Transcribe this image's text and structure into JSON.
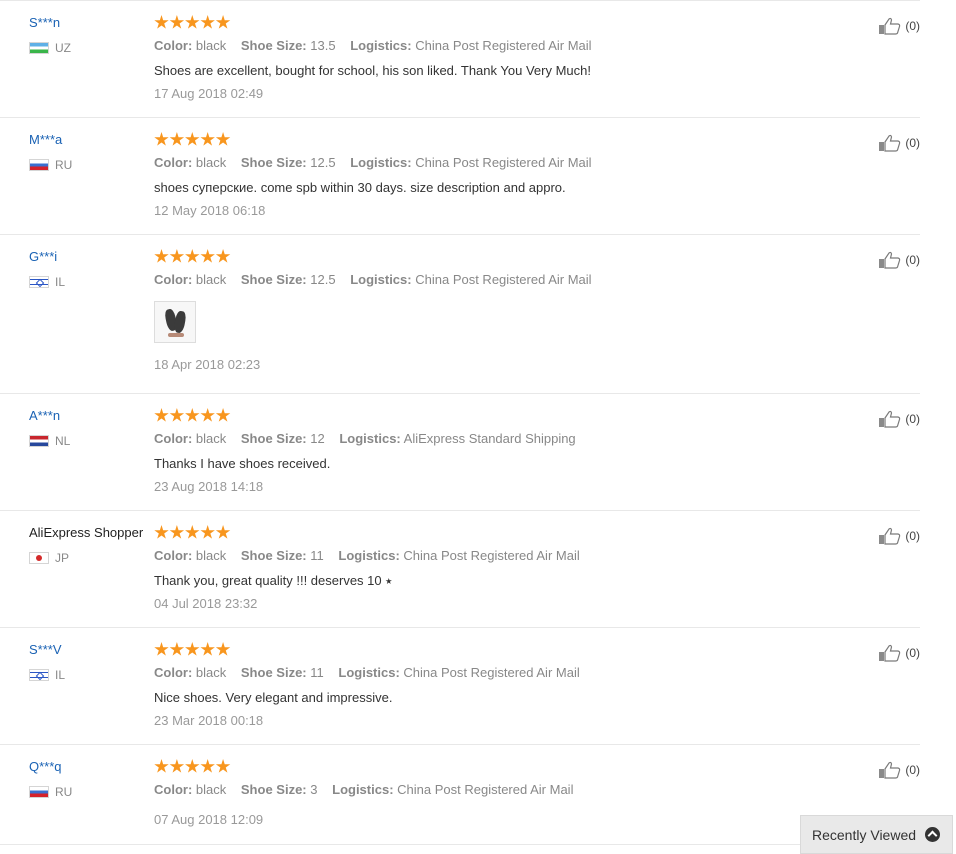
{
  "reviews": [
    {
      "user": "S***n",
      "country": "UZ",
      "flag_icon": "flag-uz-icon",
      "rating": 5,
      "color_label": "Color:",
      "color": "black",
      "size_label": "Shoe Size:",
      "size": "13.5",
      "logistics_label": "Logistics:",
      "logistics": "China Post Registered Air Mail",
      "text": "Shoes are excellent, bought for school, his son liked. Thank You Very Much!",
      "date": "17 Aug 2018 02:49",
      "helpful": "(0)"
    },
    {
      "user": "M***a",
      "country": "RU",
      "flag_icon": "flag-ru-icon",
      "rating": 5,
      "color_label": "Color:",
      "color": "black",
      "size_label": "Shoe Size:",
      "size": "12.5",
      "logistics_label": "Logistics:",
      "logistics": "China Post Registered Air Mail",
      "text": "shoes суперские. come spb within 30 days. size description and appro.",
      "date": "12 May 2018 06:18",
      "helpful": "(0)"
    },
    {
      "user": "G***i",
      "country": "IL",
      "flag_icon": "flag-il-icon",
      "rating": 5,
      "color_label": "Color:",
      "color": "black",
      "size_label": "Shoe Size:",
      "size": "12.5",
      "logistics_label": "Logistics:",
      "logistics": "China Post Registered Air Mail",
      "text": "",
      "has_photo": true,
      "date": "18 Apr 2018 02:23",
      "helpful": "(0)"
    },
    {
      "user": "A***n",
      "country": "NL",
      "flag_icon": "flag-nl-icon",
      "rating": 5,
      "color_label": "Color:",
      "color": "black",
      "size_label": "Shoe Size:",
      "size": "12",
      "logistics_label": "Logistics:",
      "logistics": "AliExpress Standard Shipping",
      "text": "Thanks I have shoes received.",
      "date": "23 Aug 2018 14:18",
      "helpful": "(0)"
    },
    {
      "user": "AliExpress Shopper",
      "country": "JP",
      "flag_icon": "flag-jp-icon",
      "rating": 5,
      "color_label": "Color:",
      "color": "black",
      "size_label": "Shoe Size:",
      "size": "11",
      "logistics_label": "Logistics:",
      "logistics": "China Post Registered Air Mail",
      "text": "Thank you, great quality !!! deserves 10 ⭑",
      "date": "04 Jul 2018 23:32",
      "helpful": "(0)"
    },
    {
      "user": "S***V",
      "country": "IL",
      "flag_icon": "flag-il-icon",
      "rating": 5,
      "color_label": "Color:",
      "color": "black",
      "size_label": "Shoe Size:",
      "size": "11",
      "logistics_label": "Logistics:",
      "logistics": "China Post Registered Air Mail",
      "text": "Nice shoes. Very elegant and impressive.",
      "date": "23 Mar 2018 00:18",
      "helpful": "(0)"
    },
    {
      "user": "Q***q",
      "country": "RU",
      "flag_icon": "flag-ru-icon",
      "rating": 5,
      "color_label": "Color:",
      "color": "black",
      "size_label": "Shoe Size:",
      "size": "3",
      "logistics_label": "Logistics:",
      "logistics": "China Post Registered Air Mail",
      "text": "",
      "date": "07 Aug 2018 12:09",
      "helpful": "(0)"
    }
  ],
  "recently_viewed": {
    "label": "Recently Viewed",
    "icon": "chevron-up-circle-icon"
  },
  "colors": {
    "star": "#f8961e",
    "link": "#1a62b4",
    "muted": "#888888"
  }
}
